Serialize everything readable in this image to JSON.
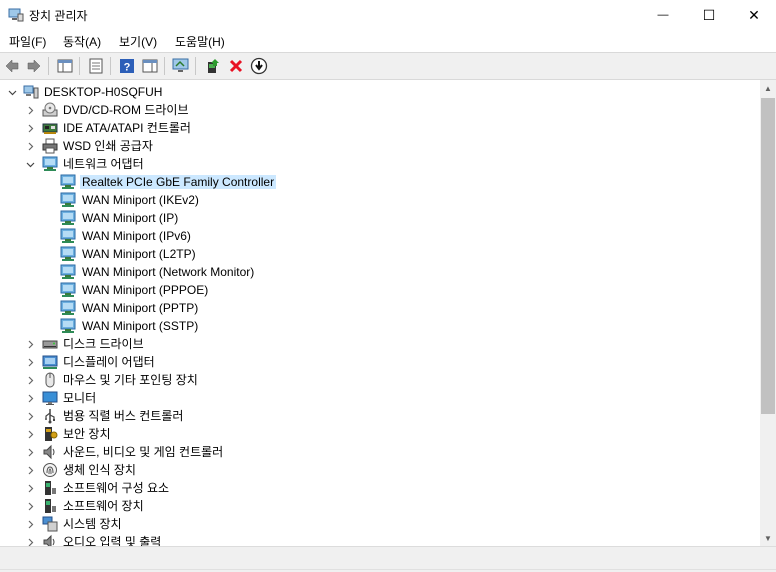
{
  "window": {
    "title": "장치 관리자",
    "minimize_glyph": "—",
    "maximize_glyph": "☐",
    "close_glyph": "✕"
  },
  "menu": [
    "파일(F)",
    "동작(A)",
    "보기(V)",
    "도움말(H)"
  ],
  "toolbar": {
    "buttons": [
      "back-icon",
      "forward-icon",
      "properties-view-icon",
      "device-list-icon",
      "help-icon",
      "action-pane-icon",
      "scan-hardware-icon",
      "update-driver-icon",
      "uninstall-icon",
      "disable-icon"
    ]
  },
  "tree": {
    "root": "DESKTOP-H0SQFUH",
    "items": [
      {
        "label": "DESKTOP-H0SQFUH",
        "level": 0,
        "expander": "expanded",
        "icon": "computer-icon"
      },
      {
        "label": "DVD/CD-ROM 드라이브",
        "level": 1,
        "expander": "collapsed",
        "icon": "dvd-drive-icon"
      },
      {
        "label": "IDE ATA/ATAPI 컨트롤러",
        "level": 1,
        "expander": "collapsed",
        "icon": "ide-controller-icon"
      },
      {
        "label": "WSD 인쇄 공급자",
        "level": 1,
        "expander": "collapsed",
        "icon": "printer-icon"
      },
      {
        "label": "네트워크 어댑터",
        "level": 1,
        "expander": "expanded",
        "icon": "network-adapter-icon"
      },
      {
        "label": "Realtek PCIe GbE Family Controller",
        "level": 2,
        "expander": "none",
        "icon": "network-adapter-icon",
        "selected": true
      },
      {
        "label": "WAN Miniport (IKEv2)",
        "level": 2,
        "expander": "none",
        "icon": "network-adapter-icon"
      },
      {
        "label": "WAN Miniport (IP)",
        "level": 2,
        "expander": "none",
        "icon": "network-adapter-icon"
      },
      {
        "label": "WAN Miniport (IPv6)",
        "level": 2,
        "expander": "none",
        "icon": "network-adapter-icon"
      },
      {
        "label": "WAN Miniport (L2TP)",
        "level": 2,
        "expander": "none",
        "icon": "network-adapter-icon"
      },
      {
        "label": "WAN Miniport (Network Monitor)",
        "level": 2,
        "expander": "none",
        "icon": "network-adapter-icon"
      },
      {
        "label": "WAN Miniport (PPPOE)",
        "level": 2,
        "expander": "none",
        "icon": "network-adapter-icon"
      },
      {
        "label": "WAN Miniport (PPTP)",
        "level": 2,
        "expander": "none",
        "icon": "network-adapter-icon"
      },
      {
        "label": "WAN Miniport (SSTP)",
        "level": 2,
        "expander": "none",
        "icon": "network-adapter-icon"
      },
      {
        "label": "디스크 드라이브",
        "level": 1,
        "expander": "collapsed",
        "icon": "disk-drive-icon"
      },
      {
        "label": "디스플레이 어댑터",
        "level": 1,
        "expander": "collapsed",
        "icon": "display-adapter-icon"
      },
      {
        "label": "마우스 및 기타 포인팅 장치",
        "level": 1,
        "expander": "collapsed",
        "icon": "mouse-icon"
      },
      {
        "label": "모니터",
        "level": 1,
        "expander": "collapsed",
        "icon": "monitor-icon"
      },
      {
        "label": "범용 직렬 버스 컨트롤러",
        "level": 1,
        "expander": "collapsed",
        "icon": "usb-icon"
      },
      {
        "label": "보안 장치",
        "level": 1,
        "expander": "collapsed",
        "icon": "security-device-icon"
      },
      {
        "label": "사운드, 비디오 및 게임 컨트롤러",
        "level": 1,
        "expander": "collapsed",
        "icon": "sound-icon"
      },
      {
        "label": "생체 인식 장치",
        "level": 1,
        "expander": "collapsed",
        "icon": "biometric-icon"
      },
      {
        "label": "소프트웨어 구성 요소",
        "level": 1,
        "expander": "collapsed",
        "icon": "software-component-icon"
      },
      {
        "label": "소프트웨어 장치",
        "level": 1,
        "expander": "collapsed",
        "icon": "software-device-icon"
      },
      {
        "label": "시스템 장치",
        "level": 1,
        "expander": "collapsed",
        "icon": "system-device-icon"
      },
      {
        "label": "오디오 입력 및 출력",
        "level": 1,
        "expander": "collapsed",
        "icon": "audio-io-icon"
      }
    ]
  },
  "colors": {
    "selection": "#cce8ff",
    "toolbar_bg": "#f0f0f0",
    "scroll_thumb": "#c1c1c1",
    "uninstall_red": "#e81123"
  },
  "scrollbar": {
    "position_fraction": 0.0,
    "visible_fraction": 0.7
  }
}
